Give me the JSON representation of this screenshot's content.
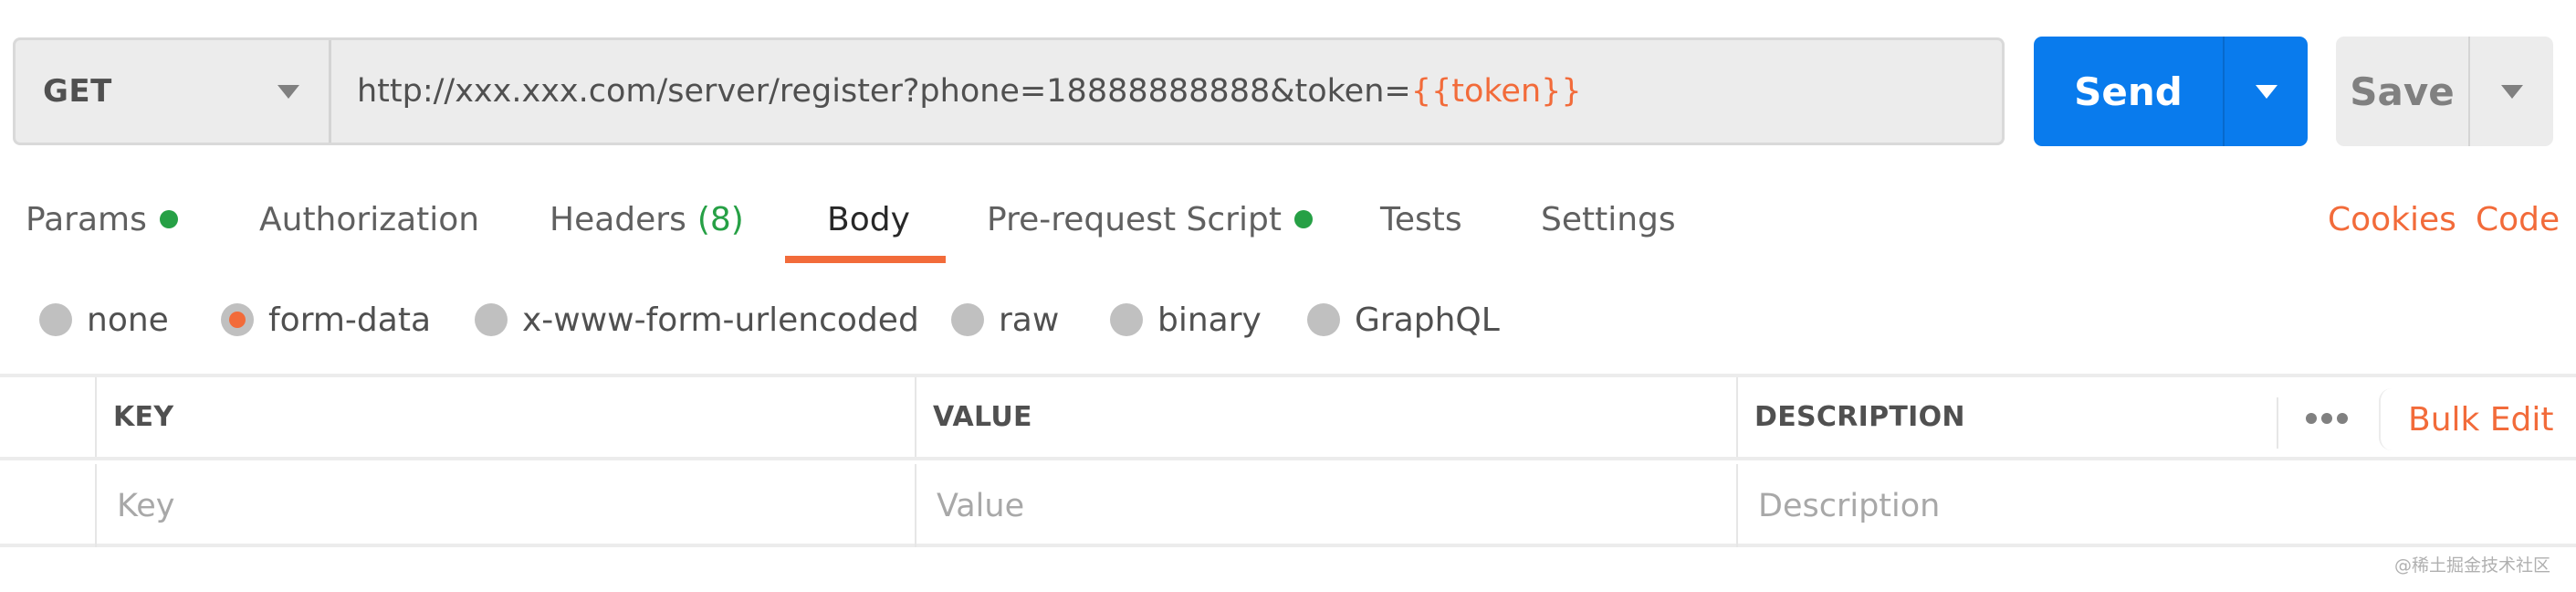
{
  "request": {
    "method": "GET",
    "url_prefix": "http://xxx.xxx.com/server/register?phone=18888888888&token=",
    "url_variable": "{{token}}",
    "send_label": "Send",
    "save_label": "Save"
  },
  "tabs": [
    {
      "label": "Params",
      "dot": true
    },
    {
      "label": "Authorization"
    },
    {
      "label": "Headers",
      "count": "(8)"
    },
    {
      "label": "Body",
      "active": true
    },
    {
      "label": "Pre-request Script",
      "dot": true
    },
    {
      "label": "Tests"
    },
    {
      "label": "Settings"
    }
  ],
  "links": {
    "cookies": "Cookies",
    "code": "Code"
  },
  "body_types": [
    {
      "label": "none",
      "checked": false
    },
    {
      "label": "form-data",
      "checked": true
    },
    {
      "label": "x-www-form-urlencoded",
      "checked": false
    },
    {
      "label": "raw",
      "checked": false
    },
    {
      "label": "binary",
      "checked": false
    },
    {
      "label": "GraphQL",
      "checked": false
    }
  ],
  "table": {
    "headers": {
      "key": "KEY",
      "value": "VALUE",
      "description": "DESCRIPTION"
    },
    "placeholders": {
      "key": "Key",
      "value": "Value",
      "description": "Description"
    },
    "bulk_edit": "Bulk Edit"
  },
  "colors": {
    "accent": "#f26b3a",
    "primary": "#097bed",
    "indicator": "#26a045"
  },
  "watermark": "@稀土掘金技术社区"
}
